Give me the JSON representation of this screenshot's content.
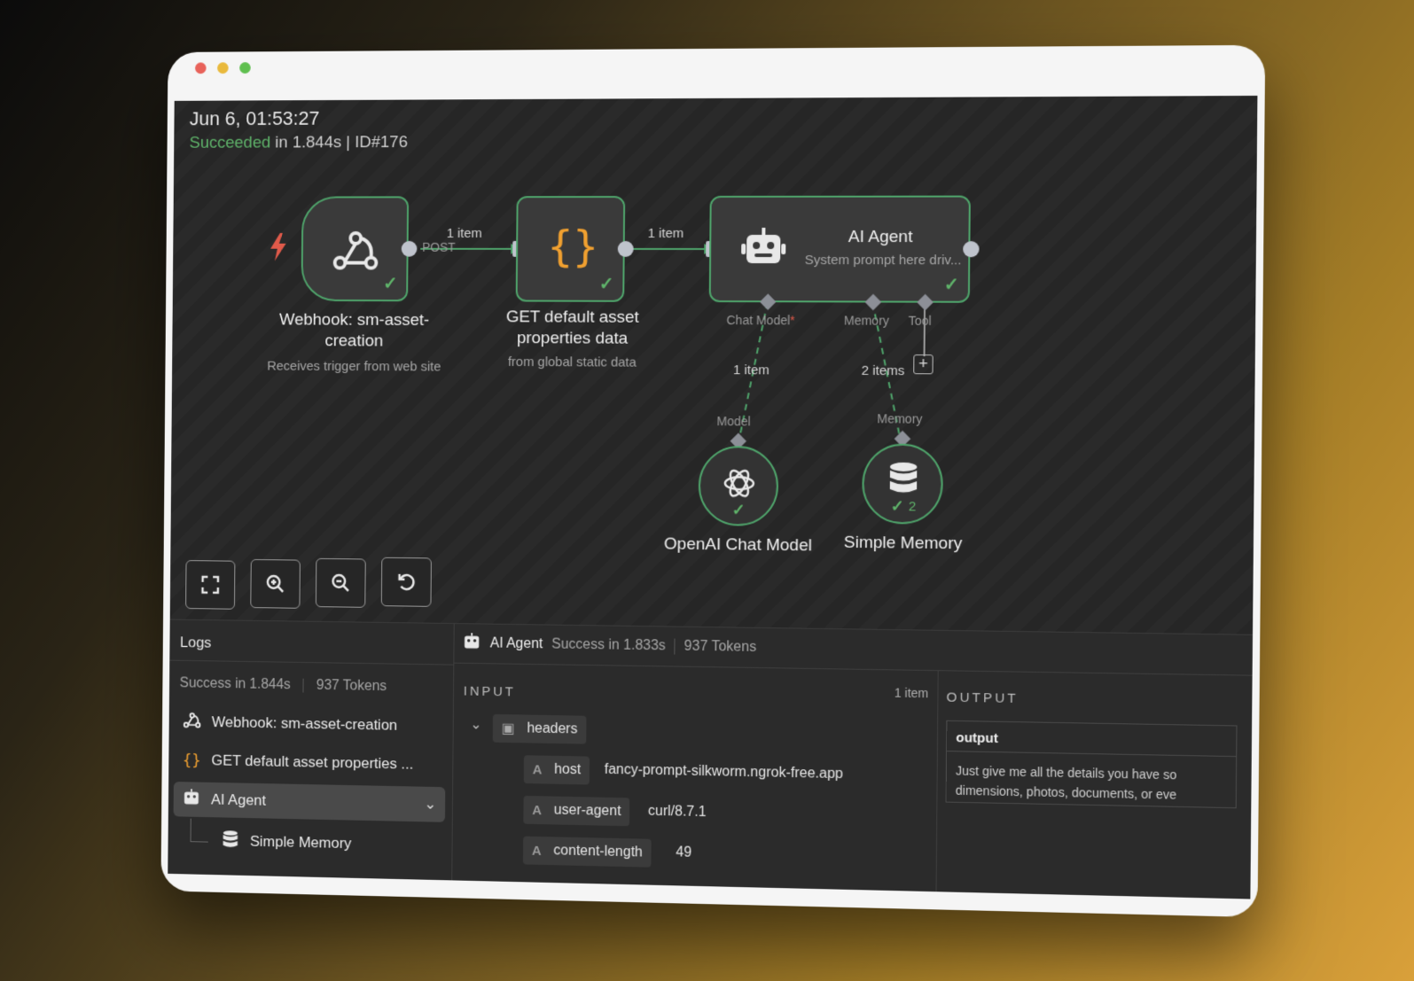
{
  "execution": {
    "date": "Jun 6, 01:53:27",
    "status": "Succeeded",
    "details": "in 1.844s | ID#176"
  },
  "nodes": {
    "webhook": {
      "title": "Webhook: sm-asset-creation",
      "subtitle": "Receives trigger from web site",
      "method": "POST"
    },
    "get_data": {
      "title": "GET default asset properties data",
      "subtitle": "from global static data"
    },
    "agent": {
      "title": "AI Agent",
      "subtitle": "System prompt here driv..."
    },
    "openai": {
      "title": "OpenAI Chat Model"
    },
    "memory": {
      "title": "Simple Memory",
      "badge": "2"
    }
  },
  "connections": {
    "webhook_to_get": "1 item",
    "get_to_agent": "1 item",
    "model_edge": "1 item",
    "memory_edge": "2 items"
  },
  "ports": {
    "chat_model": "Chat Model",
    "memory": "Memory",
    "tool": "Tool",
    "model_in": "Model",
    "memory_in": "Memory"
  },
  "controls": [
    "fit-view",
    "zoom-in",
    "zoom-out",
    "reset"
  ],
  "logs": {
    "title": "Logs",
    "summary_time": "Success in 1.844s",
    "summary_tokens": "937 Tokens",
    "items": [
      {
        "label": "Webhook: sm-asset-creation",
        "icon": "webhook-icon"
      },
      {
        "label": "GET default asset properties ...",
        "icon": "braces-icon"
      },
      {
        "label": "AI Agent",
        "icon": "robot-icon"
      },
      {
        "label": "Simple Memory",
        "icon": "database-icon"
      }
    ]
  },
  "detail": {
    "name": "AI Agent",
    "status": "Success in 1.833s",
    "tokens": "937 Tokens",
    "input_label": "INPUT",
    "output_label": "OUTPUT",
    "items_count": "1 item",
    "headers_label": "headers",
    "fields": [
      {
        "key": "host",
        "value": "fancy-prompt-silkworm.ngrok-free.app"
      },
      {
        "key": "user-agent",
        "value": "curl/8.7.1"
      },
      {
        "key": "content-length",
        "value": "49"
      }
    ],
    "output_header": "output",
    "output_line1": "Just give me all the details you have so",
    "output_line2": "dimensions, photos, documents, or eve"
  },
  "colors": {
    "success": "#5fb36a",
    "node_border": "#4fa46b",
    "accent_orange": "#f0a030",
    "trigger_red": "#e05a4a"
  }
}
